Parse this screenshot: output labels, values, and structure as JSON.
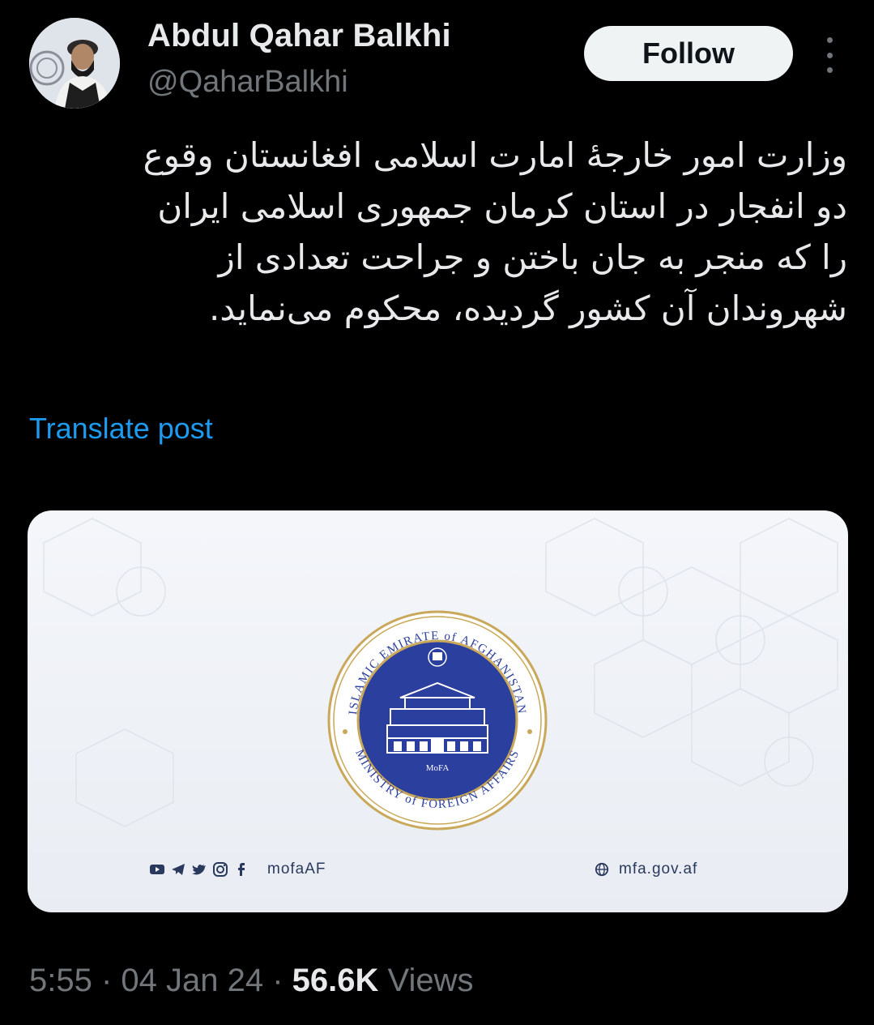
{
  "author": {
    "name": "Abdul Qahar Balkhi",
    "handle": "@QaharBalkhi"
  },
  "actions": {
    "follow_label": "Follow",
    "more_icon": "more-vertical-icon"
  },
  "post": {
    "text_lines": [
      "وزارت امور خارجۀ امارت اسلامی افغانستان وقوع",
      "دو انفجار در استان کرمان جمهوری اسلامی ایران",
      "را که منجر به جان باختن و جراحت تعدادی از",
      "شهروندان آن کشور گردیده، محکوم می‌نماید."
    ],
    "translate_label": "Translate post"
  },
  "media": {
    "seal_top_text": "ISLAMIC EMIRATE of AFGHANISTAN",
    "seal_bottom_text": "MINISTRY of FOREIGN AFFAIRS",
    "seal_center_label": "MoFA",
    "social_icons": [
      "youtube-icon",
      "telegram-icon",
      "twitter-icon",
      "instagram-icon",
      "facebook-icon"
    ],
    "social_handle": "mofaAF",
    "website": "mfa.gov.af",
    "colors": {
      "seal_blue": "#2b3f9e",
      "seal_gold": "#c9a85a",
      "text_navy": "#2a3a5e"
    }
  },
  "meta": {
    "time": "5:55",
    "separator": " · ",
    "date": "04 Jan 24",
    "views_count": "56.6K",
    "views_label": " Views"
  },
  "colors": {
    "background": "#000000",
    "text_primary": "#e7e9ea",
    "text_secondary": "#71767b",
    "link_blue": "#1d9bf0"
  }
}
